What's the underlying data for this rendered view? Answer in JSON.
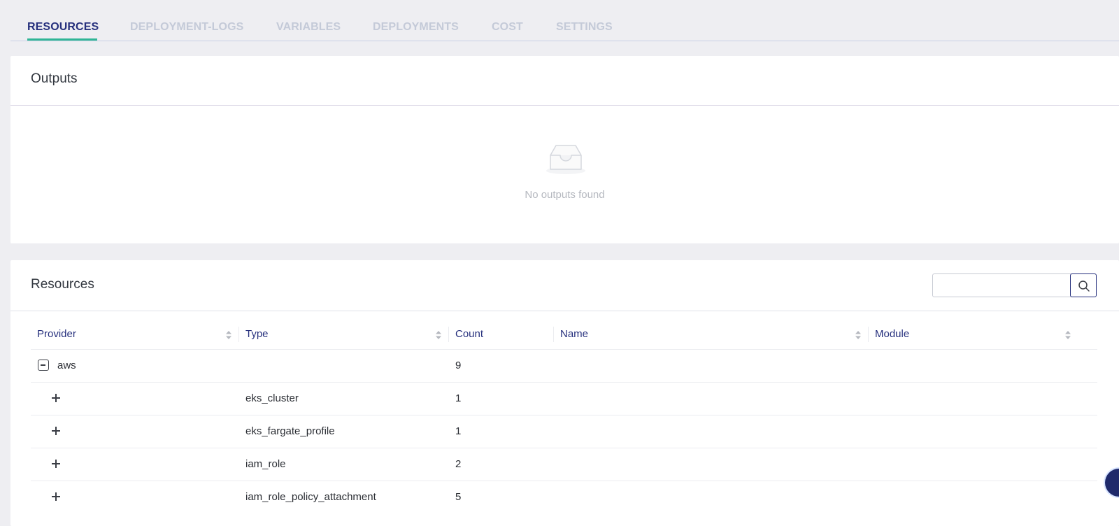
{
  "tabs": [
    {
      "label": "RESOURCES",
      "active": true
    },
    {
      "label": "DEPLOYMENT-LOGS",
      "active": false
    },
    {
      "label": "VARIABLES",
      "active": false
    },
    {
      "label": "DEPLOYMENTS",
      "active": false
    },
    {
      "label": "COST",
      "active": false
    },
    {
      "label": "SETTINGS",
      "active": false
    }
  ],
  "outputs": {
    "title": "Outputs",
    "empty_icon": "inbox-icon",
    "empty_text": "No outputs found"
  },
  "resources": {
    "title": "Resources",
    "search": {
      "value": "",
      "placeholder": "",
      "icon": "search-icon"
    },
    "columns": [
      "Provider",
      "Type",
      "Count",
      "Name",
      "Module"
    ],
    "group": {
      "provider": "aws",
      "count": "9",
      "expanded": true
    },
    "rows": [
      {
        "type": "eks_cluster",
        "count": "1"
      },
      {
        "type": "eks_fargate_profile",
        "count": "1"
      },
      {
        "type": "iam_role",
        "count": "2"
      },
      {
        "type": "iam_role_policy_attachment",
        "count": "5"
      }
    ]
  },
  "colors": {
    "accent": "#26307d",
    "tab_underline": "#2fb596",
    "inactive_tab": "#c4cad8",
    "background": "#eeeef2"
  }
}
